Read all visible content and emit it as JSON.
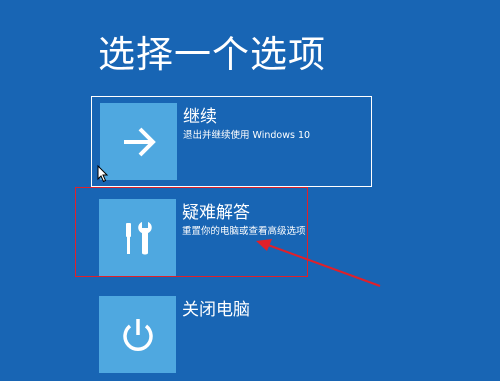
{
  "page": {
    "title": "选择一个选项"
  },
  "options": [
    {
      "id": "continue",
      "title": "继续",
      "description": "退出并继续使用 Windows 10",
      "icon": "arrow-right-icon",
      "selected": true
    },
    {
      "id": "troubleshoot",
      "title": "疑难解答",
      "description": "重置你的电脑或查看高级选项",
      "icon": "tools-icon",
      "selected": false
    },
    {
      "id": "shutdown",
      "title": "关闭电脑",
      "description": "",
      "icon": "power-icon",
      "selected": false
    }
  ],
  "colors": {
    "background": "#1865b4",
    "tile": "#4fa8e0",
    "annotation": "#e0202a",
    "text": "#ffffff"
  }
}
